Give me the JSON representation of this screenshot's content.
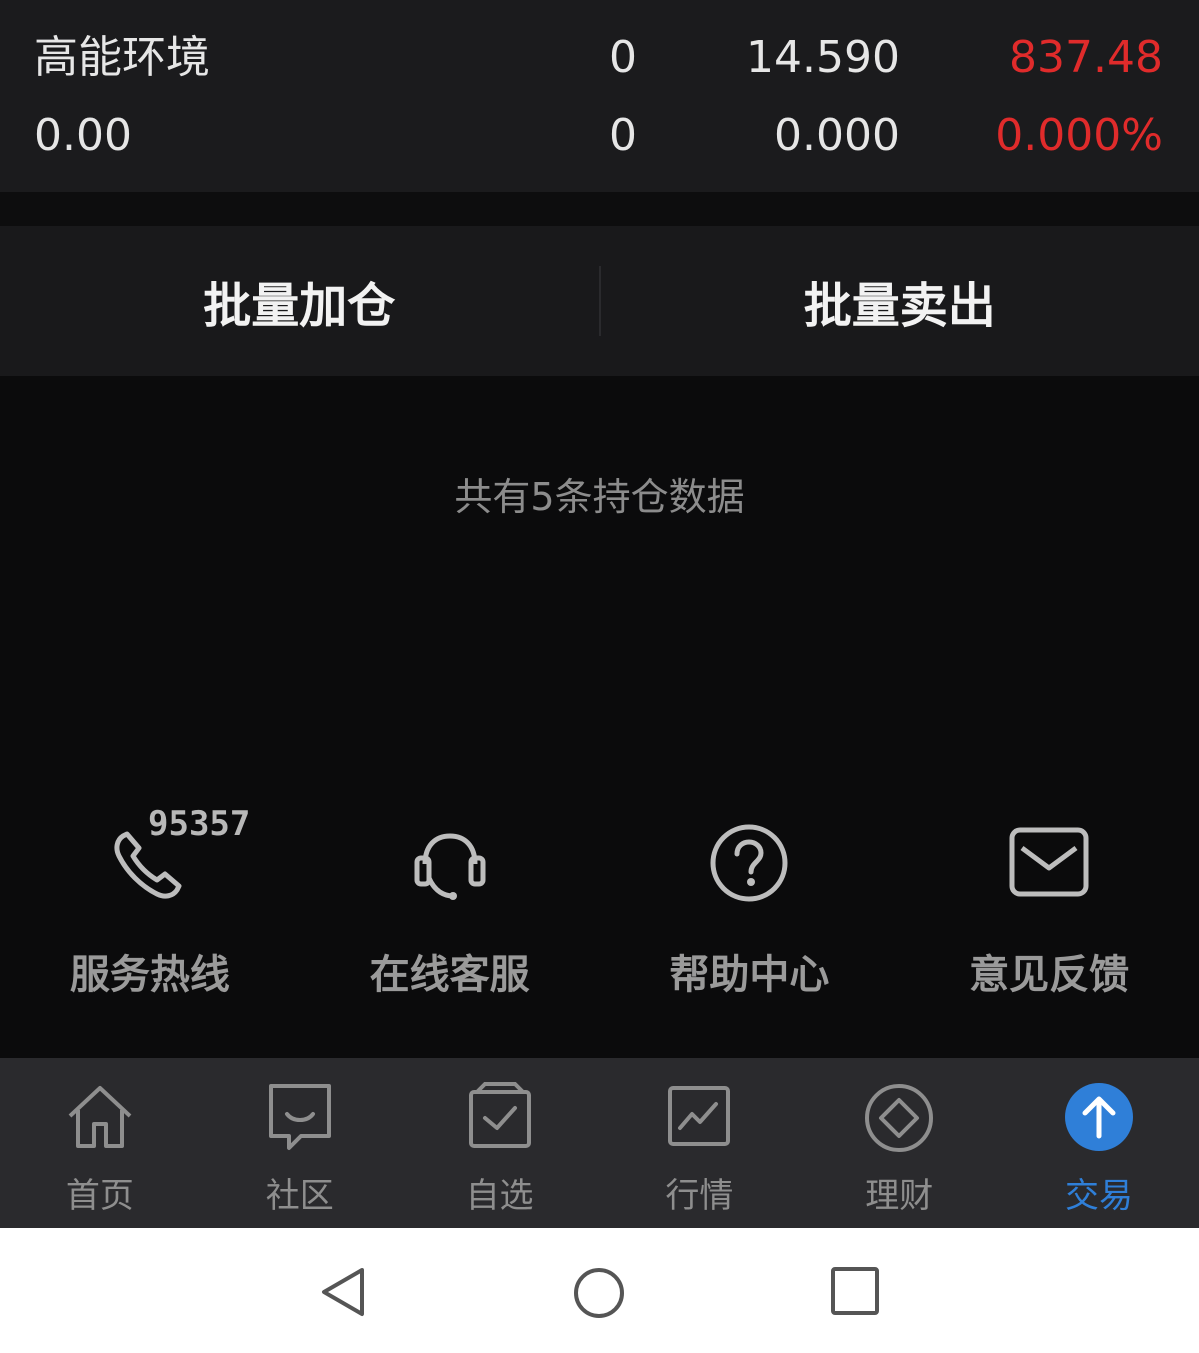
{
  "holding": {
    "name": "高能环境",
    "value": "0.00",
    "qty_total": "0",
    "qty_available": "0",
    "price_current": "14.590",
    "price_cost": "0.000",
    "profit_loss": "837.48",
    "profit_loss_pct": "0.000%",
    "accent_red": "#e02b2b"
  },
  "batch": {
    "add_label": "批量加仓",
    "sell_label": "批量卖出"
  },
  "summary": "共有5条持仓数据",
  "services": {
    "hotline_number": "95357",
    "items": [
      {
        "label": "服务热线",
        "icon": "phone-icon"
      },
      {
        "label": "在线客服",
        "icon": "headset-icon"
      },
      {
        "label": "帮助中心",
        "icon": "help-icon"
      },
      {
        "label": "意见反馈",
        "icon": "mail-icon"
      }
    ]
  },
  "tabs": [
    {
      "label": "首页",
      "icon": "home-icon"
    },
    {
      "label": "社区",
      "icon": "chat-icon"
    },
    {
      "label": "自选",
      "icon": "watchlist-icon"
    },
    {
      "label": "行情",
      "icon": "market-chart-icon"
    },
    {
      "label": "理财",
      "icon": "wealth-diamond-icon"
    },
    {
      "label": "交易",
      "icon": "trade-arrow-icon",
      "active": true
    }
  ],
  "active_color": "#2f7fd8"
}
